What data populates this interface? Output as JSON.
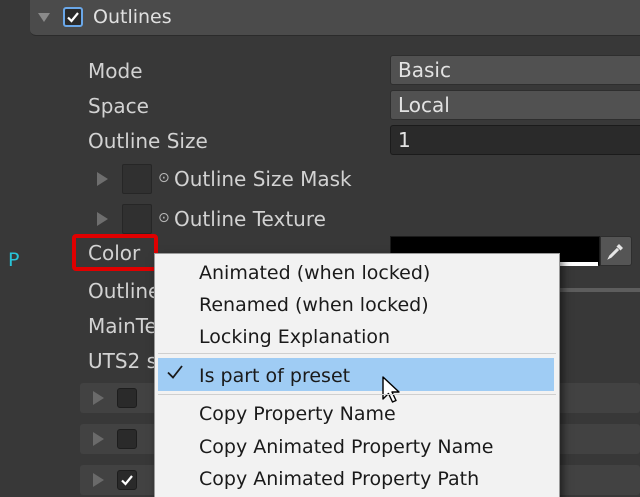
{
  "header": {
    "title": "Outlines",
    "enabled": true
  },
  "properties": {
    "mode": {
      "label": "Mode",
      "value": "Basic"
    },
    "space": {
      "label": "Space",
      "value": "Local"
    },
    "outline_size": {
      "label": "Outline Size",
      "value": "1"
    },
    "outline_size_mask": {
      "label": "Outline Size Mask",
      "icon": "info-dot"
    },
    "outline_texture": {
      "label": "Outline Texture",
      "icon": "info-dot"
    },
    "color": {
      "label": "Color",
      "swatch": "#000000",
      "alpha_bar": "#ffffff"
    },
    "row_outline": {
      "label": "Outline"
    },
    "row_main": {
      "label": "MainTe"
    },
    "row_uts": {
      "label": "UTS2 s"
    }
  },
  "preset_marker": "P",
  "context_menu": {
    "items": [
      {
        "label": "Animated (when locked)"
      },
      {
        "label": "Renamed (when locked)"
      },
      {
        "label": "Locking Explanation"
      },
      {
        "label": "Is part of preset",
        "checked": true,
        "highlighted": true
      },
      {
        "label": "Copy Property Name"
      },
      {
        "label": "Copy Animated Property Name"
      },
      {
        "label": "Copy Animated Property Path"
      }
    ]
  },
  "colors": {
    "background": "#383838",
    "highlight": "#9fccf4",
    "annotation_box": "#e00000",
    "preset_marker": "#28c4d8"
  }
}
